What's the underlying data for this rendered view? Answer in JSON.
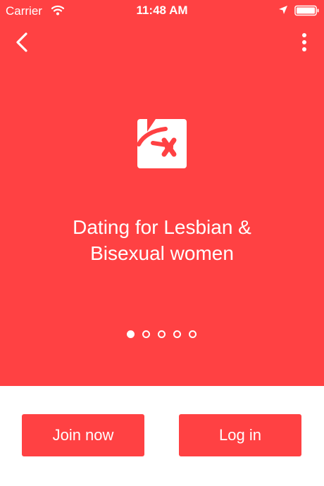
{
  "status_bar": {
    "carrier": "Carrier",
    "time": "11:48 AM",
    "icons": [
      "wifi-icon",
      "location-icon",
      "battery-icon"
    ]
  },
  "nav": {
    "back_icon": "chevron-left-icon",
    "more_icon": "more-vertical-icon"
  },
  "hero": {
    "background_color": "#ff4143",
    "logo_icon": "app-logo-icon",
    "tagline_line1": "Dating for Lesbian &",
    "tagline_line2": "Bisexual women",
    "page_count": 5,
    "active_page": 1
  },
  "actions": {
    "join_label": "Join now",
    "login_label": "Log in",
    "button_color": "#ff4143"
  }
}
